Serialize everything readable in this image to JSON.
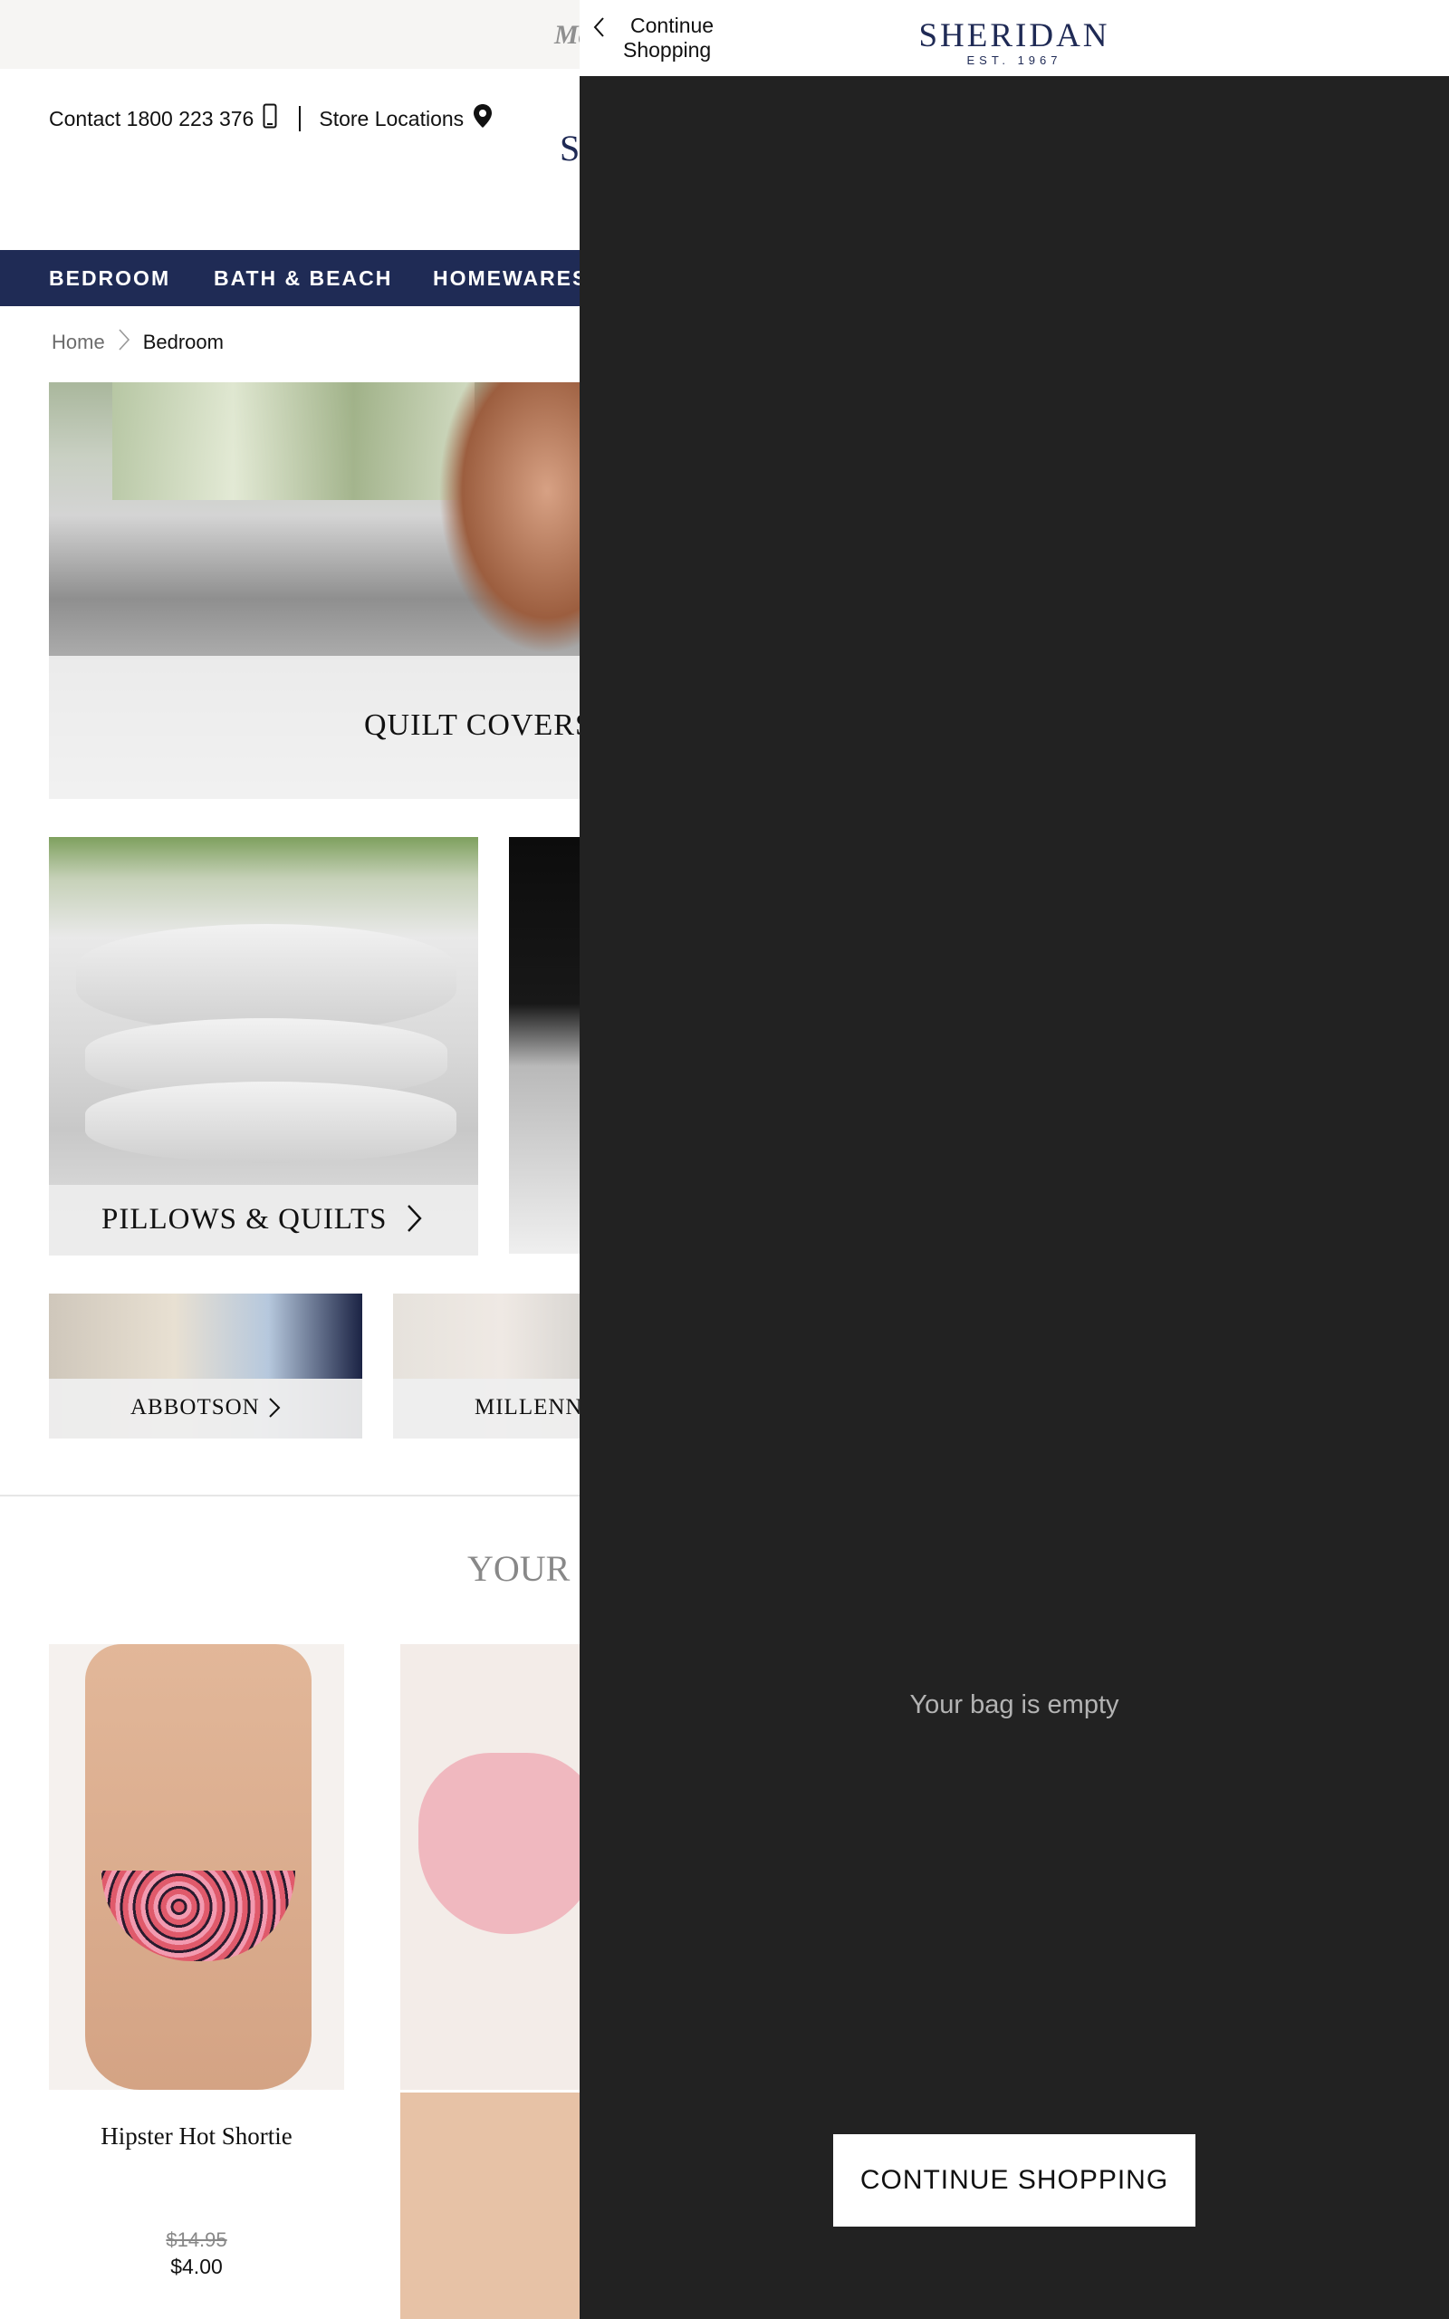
{
  "promo": {
    "text": "Ma"
  },
  "header": {
    "contact_label": "Contact 1800 223 376",
    "store_label": "Store Locations",
    "logo_peek": "S"
  },
  "nav": {
    "items": [
      "BEDROOM",
      "BATH & BEACH",
      "HOMEWARES"
    ]
  },
  "breadcrumb": {
    "home": "Home",
    "current": "Bedroom"
  },
  "tiles": {
    "hero_label": "QUILT COVERS",
    "pillows_label": "PILLOWS & QUILTS",
    "abbotson_label": "ABBOTSON",
    "millennium_label": "MILLENN"
  },
  "recommend": {
    "title": "YOUR R",
    "products": [
      {
        "name": "Hipster Hot Shortie",
        "old_price": "$14.95",
        "price": "$4.00"
      }
    ]
  },
  "drawer": {
    "back_line1": "Continue",
    "back_line2": "Shopping",
    "brand_name": "SHERIDAN",
    "brand_est": "EST. 1967",
    "empty_message": "Your bag is empty",
    "cta_label": "CONTINUE SHOPPING"
  },
  "colors": {
    "navy": "#1f2b55",
    "drawer_bg": "#222222",
    "promo_bg": "#f6f5f3"
  },
  "icons": [
    "mobile-phone-icon",
    "map-pin-icon",
    "chevron-right-icon",
    "chevron-left-icon"
  ]
}
